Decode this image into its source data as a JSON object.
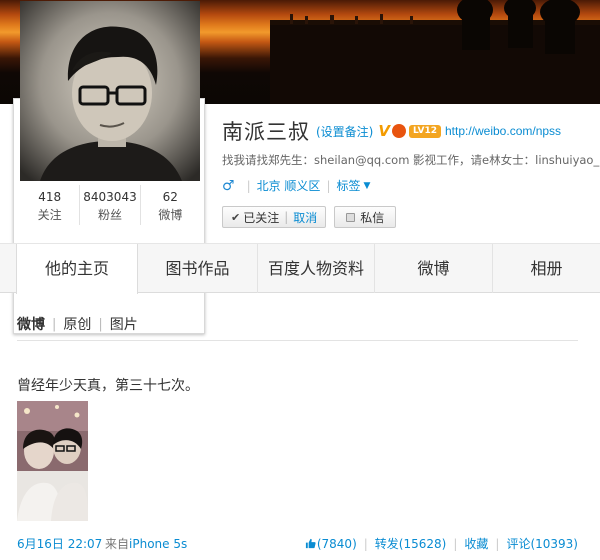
{
  "user": {
    "name": "南派三叔",
    "remark_link": "(设置备注)",
    "verified_icon": "verified-v-icon",
    "level_badge": "LV12",
    "url": "http://weibo.com/npss",
    "bio": "找我请找郑先生：sheilan@qq.com 影视工作，请e林女士：linshuiyao_",
    "gender_icon": "male-icon",
    "location": "北京 顺义区",
    "tags_label": "标签"
  },
  "stats": [
    {
      "num": "418",
      "label": "关注"
    },
    {
      "num": "8403043",
      "label": "粉丝"
    },
    {
      "num": "62",
      "label": "微博"
    }
  ],
  "actions": {
    "follow_label": "已关注",
    "unfollow_label": "取消",
    "message_label": "私信"
  },
  "tabs": [
    {
      "label": "他的主页"
    },
    {
      "label": "图书作品"
    },
    {
      "label": "百度人物资料"
    },
    {
      "label": "微博"
    },
    {
      "label": "相册"
    }
  ],
  "feed_filter": {
    "weibo": "微博",
    "original": "原创",
    "pictures": "图片"
  },
  "post": {
    "text": "曾经年少天真，第三十七次。",
    "time": "6月16日 22:07",
    "source_prefix": "来自",
    "source_app": "iPhone 5s",
    "likes": "(7840)",
    "repost": "转发(15628)",
    "favorite": "收藏",
    "comment": "评论(10393)"
  },
  "colors": {
    "link": "#0a8cd2",
    "level_badge": "#f3a521",
    "verified": "#f39b00"
  }
}
